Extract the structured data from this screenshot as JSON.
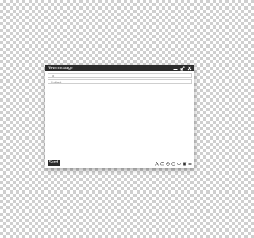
{
  "window": {
    "title": "New message",
    "controls": [
      "minimize-icon",
      "expand-icon",
      "close-icon"
    ]
  },
  "fields": {
    "to_placeholder": "To",
    "subject_placeholder": "Subject"
  },
  "footer": {
    "send_label": "Send",
    "tools": [
      "text-format-icon",
      "attach-icon",
      "link-icon",
      "emoji-icon",
      "image-icon",
      "trash-icon",
      "more-options-icon"
    ]
  },
  "colors": {
    "titlebar": "#2b2b2b",
    "send_button": "#2b2b2b",
    "window": "#ffffff"
  }
}
